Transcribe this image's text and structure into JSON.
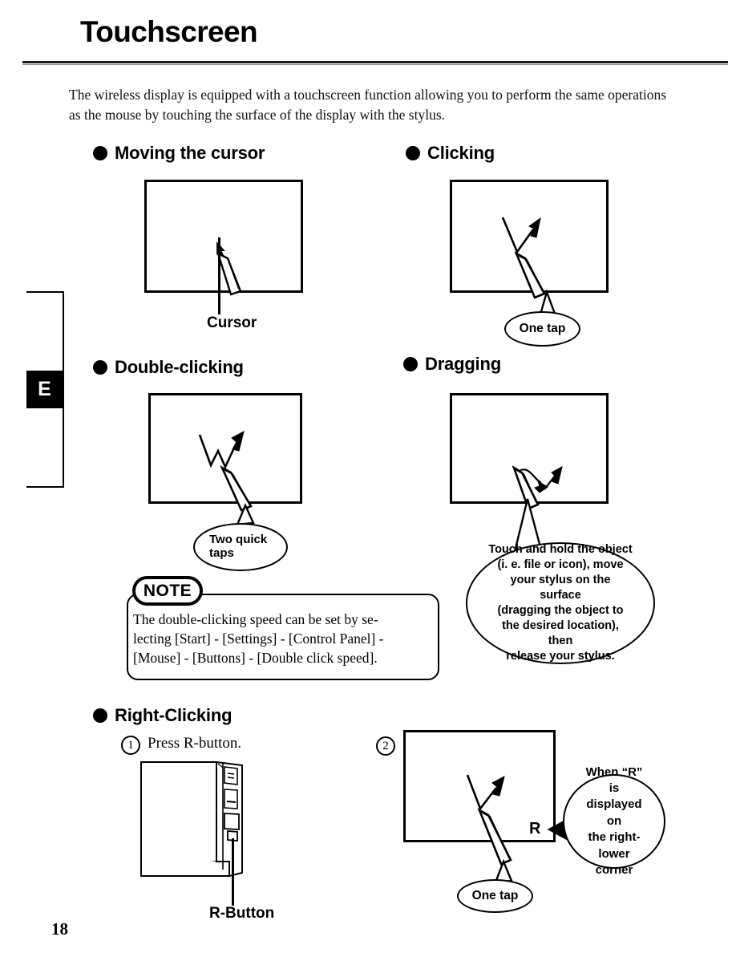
{
  "document": {
    "title": "Touchscreen",
    "page_number": "18",
    "index_tab_letter": "E"
  },
  "intro": {
    "text": "The wireless display is equipped with a touchscreen function allowing you to perform the same operations as the mouse by touching the surface of the display with the stylus."
  },
  "sections": {
    "moving_cursor": {
      "heading": "Moving the cursor",
      "caption": "Cursor"
    },
    "clicking": {
      "heading": "Clicking",
      "callout": "One tap"
    },
    "double_clicking": {
      "heading": "Double-clicking",
      "callout_line1": "Two quick",
      "callout_line2": "taps"
    },
    "dragging": {
      "heading": "Dragging",
      "callout_line1": "Touch and hold the object",
      "callout_line2": "(i. e. file or icon), move",
      "callout_line3": "your stylus on the surface",
      "callout_line4": "(dragging the object to",
      "callout_line5": "the desired location), then",
      "callout_line6": "release your stylus."
    },
    "right_clicking": {
      "heading": "Right-Clicking",
      "step1_number": "1",
      "step1_text": "Press R-button.",
      "step2_number": "2",
      "r_button_label": "R-Button",
      "r_indicator": "R",
      "callout_line1": "When “R” is",
      "callout_line2": "displayed on",
      "callout_line3": "the  right-",
      "callout_line4": "lower corner",
      "callout": "One tap"
    }
  },
  "note": {
    "badge": "NOTE",
    "line1": "The double-clicking speed can be set by se-",
    "line2": "lecting [Start] - [Settings] - [Control Panel] -",
    "line3": "[Mouse] - [Buttons] - [Double click speed]."
  },
  "colors": {
    "ink": "#000000",
    "paper": "#ffffff"
  }
}
